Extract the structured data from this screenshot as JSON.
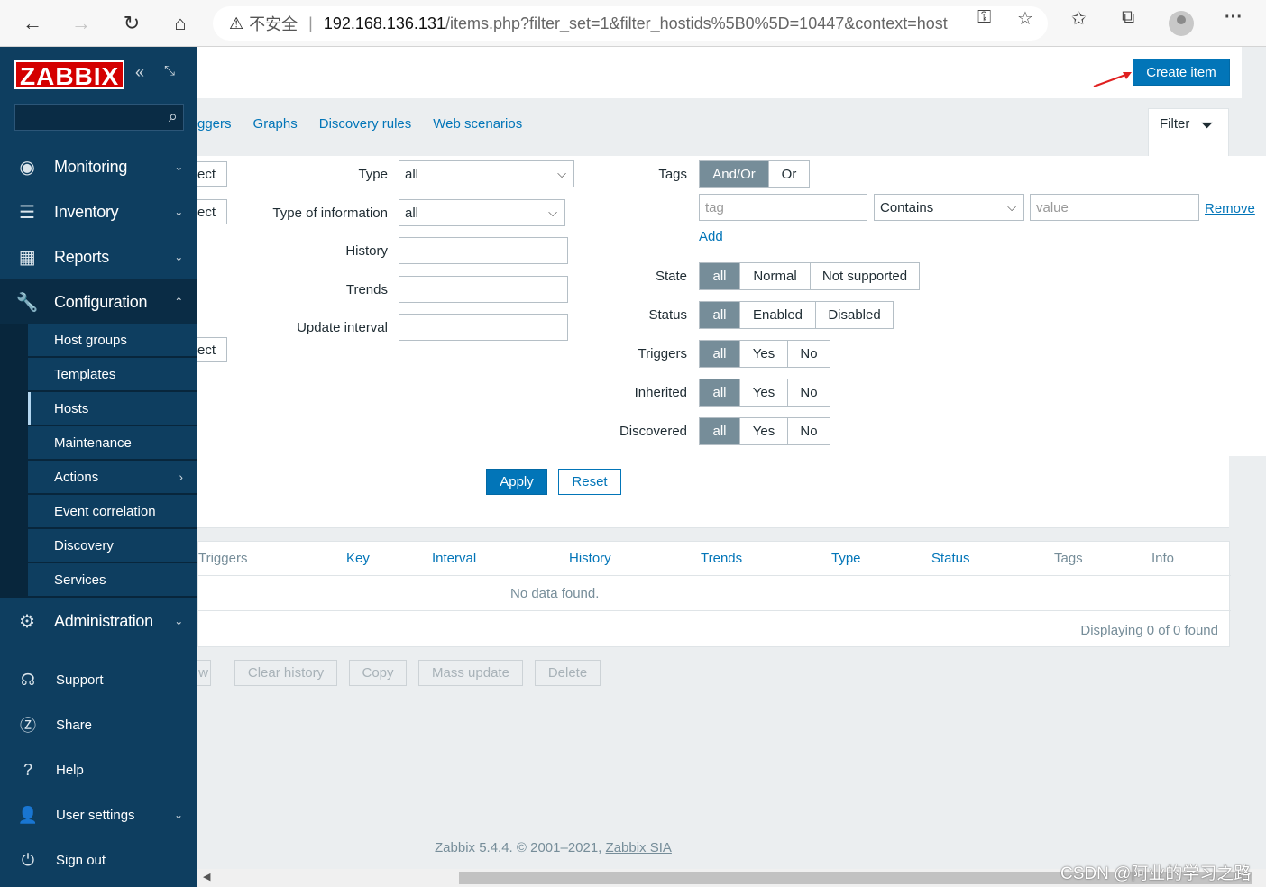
{
  "browser": {
    "insecure_label": "不安全",
    "url_host": "192.168.136.131",
    "url_path": "/items.php?filter_set=1&filter_hostids%5B0%5D=10447&context=host"
  },
  "sidebar": {
    "logo": "ZABBIX",
    "menu": {
      "monitoring": "Monitoring",
      "inventory": "Inventory",
      "reports": "Reports",
      "configuration": "Configuration",
      "administration": "Administration"
    },
    "config_items": [
      "Host groups",
      "Templates",
      "Hosts",
      "Maintenance",
      "Actions",
      "Event correlation",
      "Discovery",
      "Services"
    ],
    "bottom": {
      "support": "Support",
      "share": "Share",
      "help": "Help",
      "user_settings": "User settings",
      "sign_out": "Sign out"
    }
  },
  "header": {
    "create_item": "Create item"
  },
  "tabs": [
    "ggers",
    "Graphs",
    "Discovery rules",
    "Web scenarios"
  ],
  "filter_tab": "Filter",
  "filter": {
    "partial_select": "ect",
    "type_label": "Type",
    "type_value": "all",
    "type_info_label": "Type of information",
    "type_info_value": "all",
    "history_label": "History",
    "trends_label": "Trends",
    "update_interval_label": "Update interval",
    "tags_label": "Tags",
    "tags_and_or": "And/Or",
    "tags_or": "Or",
    "tag_placeholder": "tag",
    "tag_operator": "Contains",
    "value_placeholder": "value",
    "remove": "Remove",
    "add": "Add",
    "state_label": "State",
    "state_options": [
      "all",
      "Normal",
      "Not supported"
    ],
    "status_label": "Status",
    "status_options": [
      "all",
      "Enabled",
      "Disabled"
    ],
    "triggers_label": "Triggers",
    "inherited_label": "Inherited",
    "discovered_label": "Discovered",
    "yesno_options": [
      "all",
      "Yes",
      "No"
    ],
    "apply": "Apply",
    "reset": "Reset"
  },
  "table": {
    "columns": [
      "Triggers",
      "Key",
      "Interval",
      "History",
      "Trends",
      "Type",
      "Status",
      "Tags",
      "Info"
    ],
    "no_data": "No data found.",
    "displaying": "Displaying 0 of 0 found"
  },
  "mass_actions": {
    "partial": "w",
    "clear_history": "Clear history",
    "copy": "Copy",
    "mass_update": "Mass update",
    "delete": "Delete"
  },
  "footer": {
    "text": "Zabbix 5.4.4. © 2001–2021,",
    "link": "Zabbix SIA"
  },
  "watermark": "CSDN @阿业的学习之路",
  "colors": {
    "sidebar": "#0e3e60",
    "accent": "#0275b8",
    "logo_red": "#d40000",
    "segment_on": "#768d99"
  }
}
